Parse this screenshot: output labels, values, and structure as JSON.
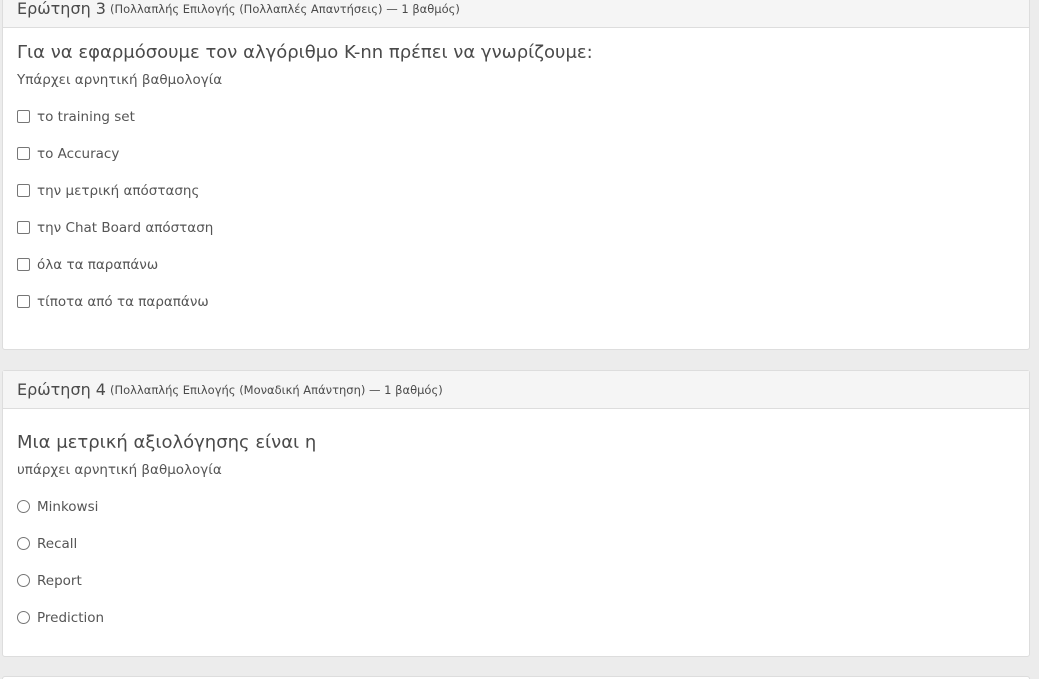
{
  "q3": {
    "title": "Ερώτηση 3",
    "meta": "(Πολλαπλής Επιλογής (Πολλαπλές Απαντήσεις) — 1 βαθμός)",
    "question": "Για να εφαρμόσουμε τον αλγόριθμο K-nn πρέπει να γνωρίζουμε:",
    "note": "Υπάρχει αρνητική βαθμολογία",
    "options": [
      {
        "label": "το training set"
      },
      {
        "label": "το Accuracy"
      },
      {
        "label": "την μετρική απόστασης"
      },
      {
        "label": "την Chat Board απόσταση"
      },
      {
        "label": "όλα τα παραπάνω"
      },
      {
        "label": "τίποτα από τα παραπάνω"
      }
    ]
  },
  "q4": {
    "title": "Ερώτηση 4",
    "meta": "(Πολλαπλής Επιλογής (Μοναδική Απάντηση) — 1 βαθμός)",
    "question": "Μια μετρική αξιολόγησης είναι η",
    "note": "υπάρχει αρνητική βαθμολογία",
    "options": [
      {
        "label": "Minkowsi"
      },
      {
        "label": "Recall"
      },
      {
        "label": "Report"
      },
      {
        "label": "Prediction"
      }
    ]
  }
}
